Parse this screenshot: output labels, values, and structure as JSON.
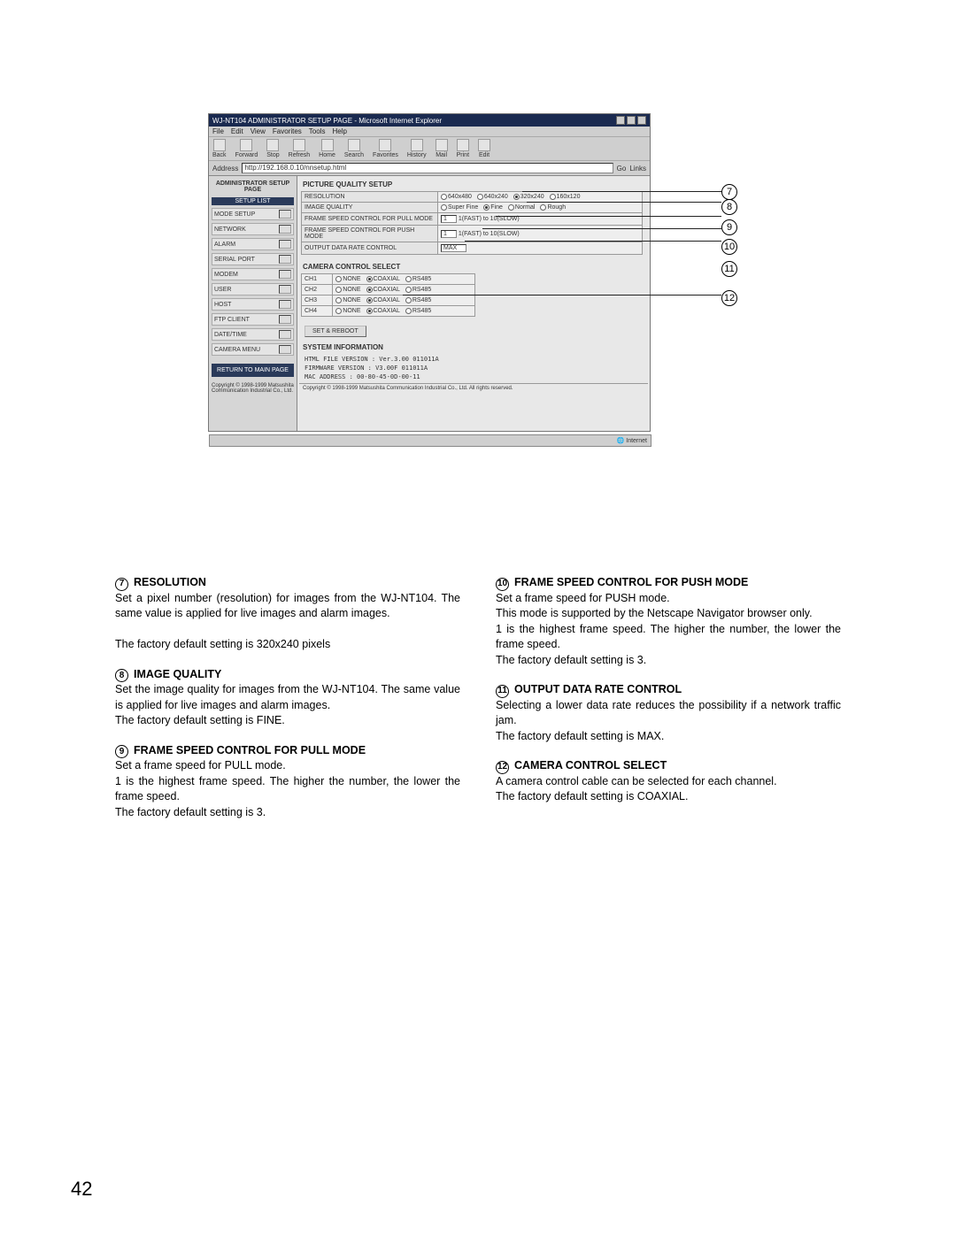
{
  "window": {
    "title": "WJ-NT104 ADMINISTRATOR SETUP PAGE - Microsoft Internet Explorer",
    "menus": [
      "File",
      "Edit",
      "View",
      "Favorites",
      "Tools",
      "Help"
    ],
    "toolbar": [
      "Back",
      "Forward",
      "Stop",
      "Refresh",
      "Home",
      "Search",
      "Favorites",
      "History",
      "Mail",
      "Print",
      "Edit"
    ],
    "addr_label": "Address",
    "addr": "http://192.168.0.10/nnsetup.html",
    "go": "Go",
    "links": "Links",
    "status": "Internet"
  },
  "sidebar": {
    "heading": "ADMINISTRATOR SETUP PAGE",
    "listhead": "SETUP LIST",
    "items": [
      "MODE SETUP",
      "NETWORK",
      "ALARM",
      "SERIAL PORT",
      "MODEM",
      "USER",
      "HOST",
      "FTP CLIENT",
      "DATE/TIME",
      "CAMERA MENU"
    ],
    "return": "RETURN TO MAIN PAGE",
    "copyright": "Copyright © 1998-1999 Matsushita Communication Industrial Co., Ltd."
  },
  "content": {
    "pq_title": "PICTURE QUALITY SETUP",
    "rows": {
      "res_label": "RESOLUTION",
      "res_opts": [
        "640x480",
        "640x240",
        "320x240",
        "160x120"
      ],
      "iq_label": "IMAGE QUALITY",
      "iq_opts": [
        "Super Fine",
        "Fine",
        "Normal",
        "Rough"
      ],
      "pull_label": "FRAME SPEED CONTROL FOR PULL MODE",
      "pull_val": "1",
      "pull_hint": "1(FAST) to 10(SLOW)",
      "push_label": "FRAME SPEED CONTROL FOR PUSH MODE",
      "push_val": "1",
      "push_hint": "1(FAST) to 10(SLOW)",
      "out_label": "OUTPUT DATA RATE CONTROL",
      "out_val": "MAX"
    },
    "cc_title": "CAMERA CONTROL SELECT",
    "cc_opts": [
      "NONE",
      "COAXIAL",
      "RS485"
    ],
    "cc_ch": [
      "CH1",
      "CH2",
      "CH3",
      "CH4"
    ],
    "setbtn": "SET & REBOOT",
    "sys_title": "SYSTEM INFORMATION",
    "sys1": "HTML FILE VERSION : Ver.3.00 011011A",
    "sys2": "FIRMWARE VERSION : V3.00F 011011A",
    "sys3": "MAC ADDRESS : 00-80-45-0D-00-11",
    "footer": "Copyright © 1998-1999 Matsushita Communication Industrial Co., Ltd. All rights reserved."
  },
  "callouts": {
    "n7": "7",
    "n8": "8",
    "n9": "9",
    "n10": "10",
    "n11": "11",
    "n12": "12"
  },
  "text": {
    "s7": {
      "title": "RESOLUTION",
      "p1": "Set a pixel number (resolution) for images from the WJ-NT104. The same value is applied for live images and alarm images.",
      "p2": "The factory default setting is 320x240 pixels"
    },
    "s8": {
      "title": "IMAGE QUALITY",
      "p1": "Set the image quality for images from the WJ-NT104. The same value is applied for live images and alarm images.",
      "p2": "The factory default setting is FINE."
    },
    "s9": {
      "title": "FRAME SPEED CONTROL FOR PULL MODE",
      "p1": "Set a frame speed for PULL mode.",
      "p2": "1 is the highest frame speed. The higher the number, the lower the frame speed.",
      "p3": "The factory default setting is 3."
    },
    "s10": {
      "title": "FRAME SPEED CONTROL FOR PUSH MODE",
      "p1": "Set a frame speed for PUSH mode.",
      "p2": "This mode is supported by the Netscape Navigator browser only.",
      "p3": "1 is the highest frame speed. The higher the number, the lower the frame speed.",
      "p4": "The factory default setting is 3."
    },
    "s11": {
      "title": "OUTPUT DATA RATE CONTROL",
      "p1": "Selecting a lower data rate reduces the possibility if a network traffic jam.",
      "p2": "The factory default setting is MAX."
    },
    "s12": {
      "title": "CAMERA CONTROL SELECT",
      "p1": "A camera control cable can be selected for each channel.",
      "p2": "The factory default setting is COAXIAL."
    }
  },
  "page": "42"
}
